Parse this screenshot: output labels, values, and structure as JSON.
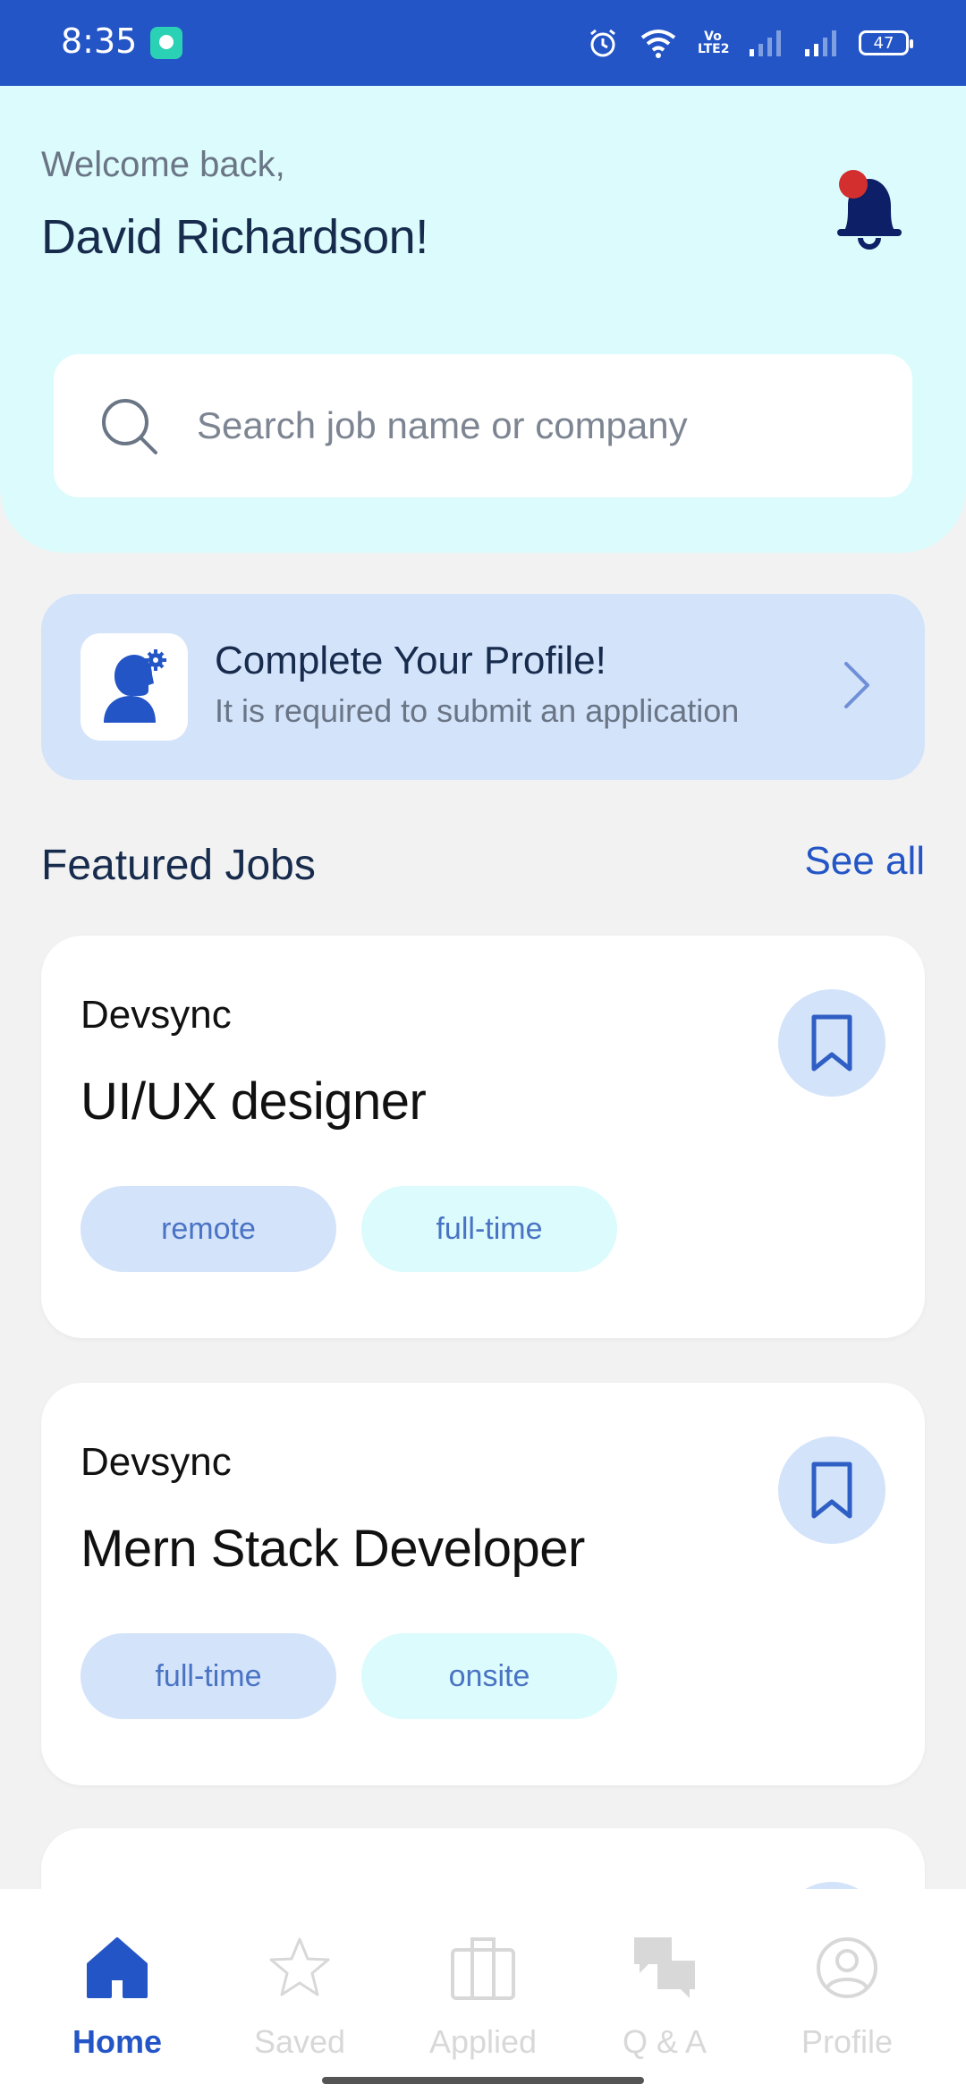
{
  "status_bar": {
    "time": "8:35",
    "battery": "47",
    "volte": "Vo LTE2",
    "icons": [
      "alarm-icon",
      "wifi-icon",
      "volte-icon",
      "signal-icon",
      "signal-icon",
      "battery-icon"
    ]
  },
  "header": {
    "welcome": "Welcome back,",
    "user_name": "David Richardson!",
    "notification_icon": "bell-icon"
  },
  "search": {
    "placeholder": "Search job name or company",
    "value": ""
  },
  "profile_card": {
    "title": "Complete Your Profile!",
    "subtitle": "It is required to submit an application"
  },
  "featured": {
    "title": "Featured Jobs",
    "see_all": "See all",
    "jobs": [
      {
        "company": "Devsync",
        "title": "UI/UX designer",
        "tags": [
          "remote",
          "full-time"
        ]
      },
      {
        "company": "Devsync",
        "title": "Mern Stack Developer",
        "tags": [
          "full-time",
          "onsite"
        ]
      }
    ]
  },
  "bottom_nav": {
    "items": [
      {
        "label": "Home",
        "icon": "home-icon",
        "active": true
      },
      {
        "label": "Saved",
        "icon": "star-icon",
        "active": false
      },
      {
        "label": "Applied",
        "icon": "briefcase-icon",
        "active": false
      },
      {
        "label": "Q & A",
        "icon": "chat-icon",
        "active": false
      },
      {
        "label": "Profile",
        "icon": "user-icon",
        "active": false
      }
    ]
  },
  "colors": {
    "primary": "#2355c6",
    "header_bg": "#dcfbfc",
    "card_tint": "#d3e3fa",
    "notification_dot": "#d32f2f"
  }
}
